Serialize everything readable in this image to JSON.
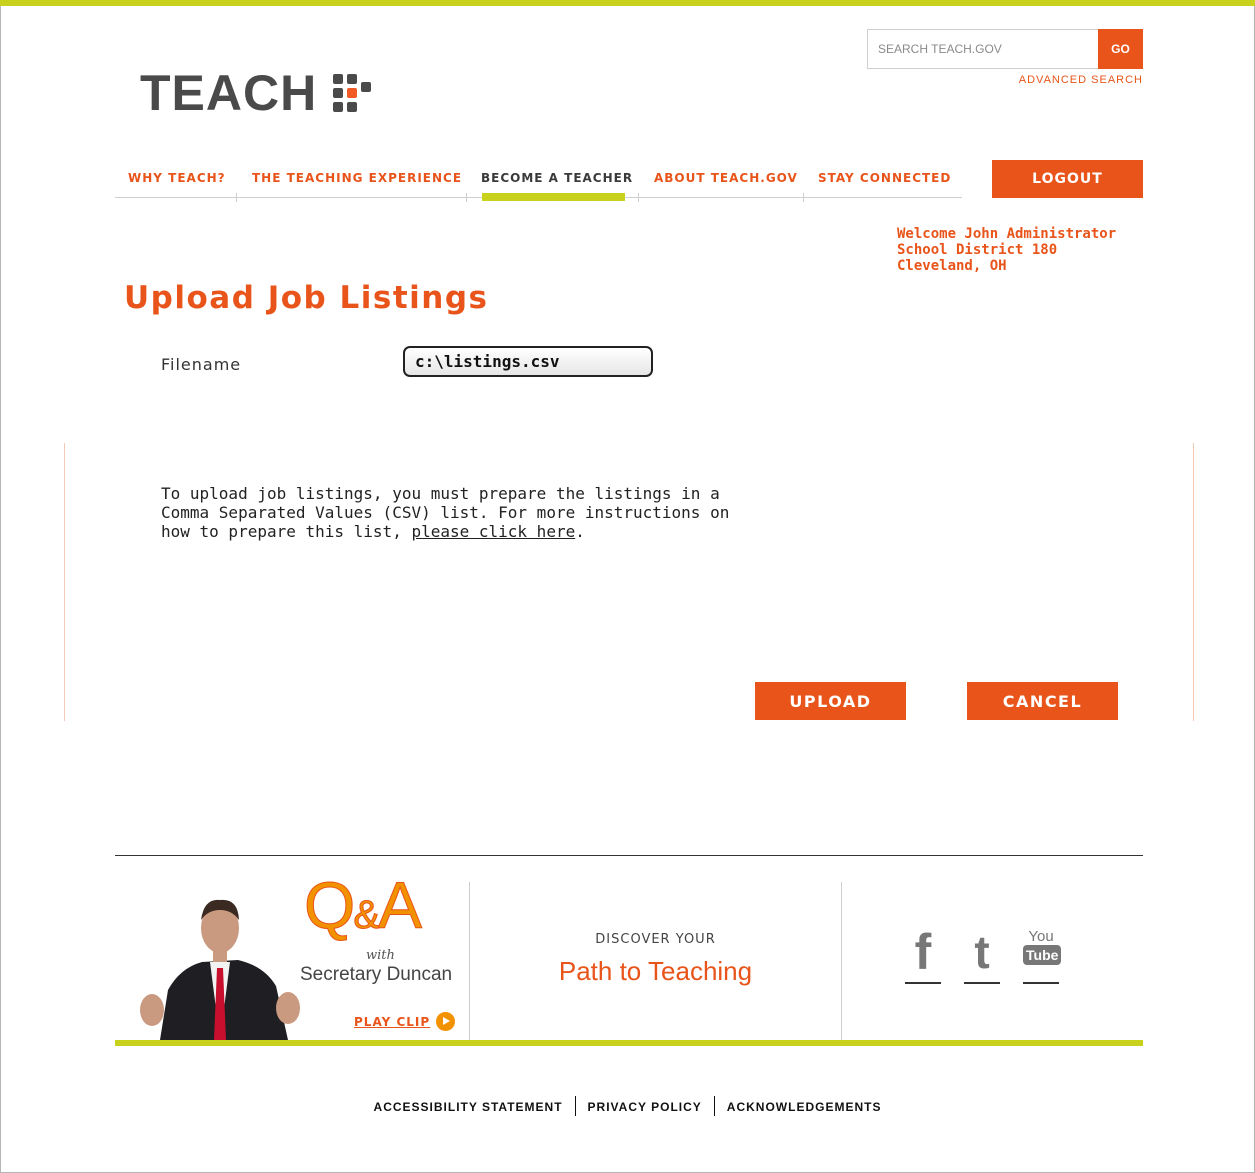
{
  "header": {
    "logo_text": "TEACH",
    "search": {
      "placeholder": "SEARCH TEACH.GOV",
      "go_label": "GO",
      "advanced_label": "ADVANCED SEARCH"
    },
    "nav": [
      {
        "label": "WHY TEACH?"
      },
      {
        "label": "THE TEACHING EXPERIENCE"
      },
      {
        "label": "BECOME A TEACHER",
        "active": true
      },
      {
        "label": "ABOUT TEACH.GOV"
      },
      {
        "label": "STAY CONNECTED"
      }
    ],
    "logout_label": "LOGOUT"
  },
  "welcome": {
    "line1": "Welcome John Administrator",
    "line2": "School District 180",
    "line3": "Cleveland, OH"
  },
  "main": {
    "title": "Upload Job Listings",
    "filename_label": "Filename",
    "filename_value": "c:\\listings.csv",
    "instructions_text": "To upload job listings, you must prepare the listings in a Comma Separated Values (CSV) list.  For more instructions on how to prepare this list, ",
    "instructions_link": "please click here",
    "instructions_end": ".",
    "upload_label": "UPLOAD",
    "cancel_label": "CANCEL"
  },
  "footer": {
    "qa": {
      "title_q": "Q",
      "title_amp": "&",
      "title_a": "A",
      "with": "with",
      "secretary": "Secretary Duncan",
      "play_label": "PLAY CLIP"
    },
    "discover": {
      "kicker": "DISCOVER YOUR",
      "title": "Path to Teaching"
    },
    "social": [
      {
        "name": "facebook-icon",
        "glyph": "f"
      },
      {
        "name": "twitter-icon",
        "glyph": "t"
      },
      {
        "name": "youtube-icon",
        "glyph_top": "You",
        "glyph_bottom": "Tube"
      }
    ],
    "links": [
      "ACCESSIBILITY STATEMENT",
      "PRIVACY POLICY",
      "ACKNOWLEDGEMENTS"
    ]
  },
  "colors": {
    "accent": "#e8541a",
    "brand_green": "#c8d21d",
    "logo_gray": "#4a4a4a"
  }
}
